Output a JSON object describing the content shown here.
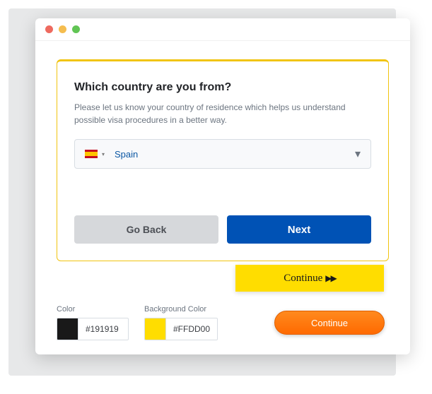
{
  "form": {
    "title": "Which country are you from?",
    "subtitle": "Please let us know your country of residence which helps us understand possible visa procedures in a better way.",
    "selected_country": "Spain",
    "back_label": "Go Back",
    "next_label": "Next"
  },
  "continue_yellow_label": "Continue",
  "continue_orange_label": "Continue",
  "props": {
    "color_label": "Color",
    "color_value": "#191919",
    "bg_label": "Background Color",
    "bg_value": "#FFDD00"
  }
}
